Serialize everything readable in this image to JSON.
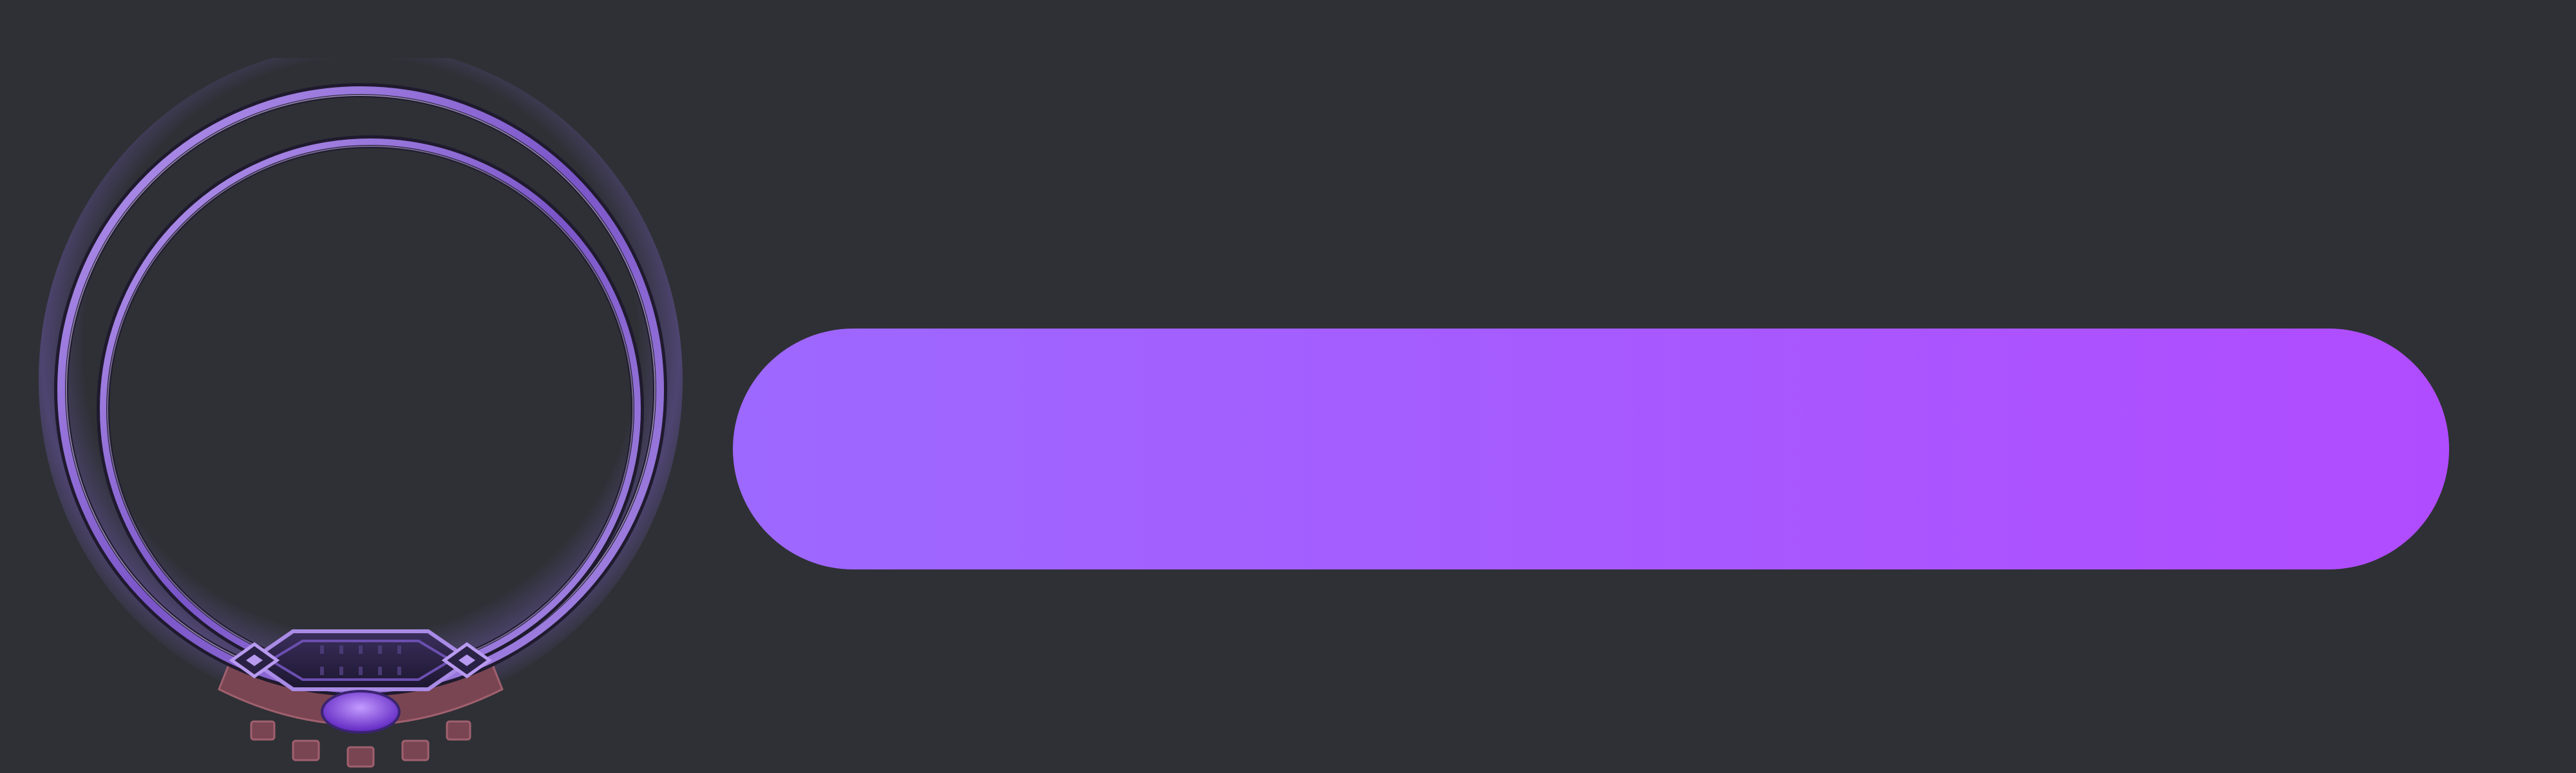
{
  "frame": {
    "icon": "ornate-avatar-frame",
    "colors": {
      "background": "#2e3035",
      "ring_light": "#a98be6",
      "ring_mid": "#7a55c8",
      "ring_dark": "#1f1a2e",
      "glow": "#8a6be0",
      "gem": "#7c3de8",
      "bronze": "#8a4f5c"
    }
  },
  "name_bar": {
    "label": "",
    "colors": {
      "start": "#9d68ff",
      "end": "#b04cff"
    }
  }
}
